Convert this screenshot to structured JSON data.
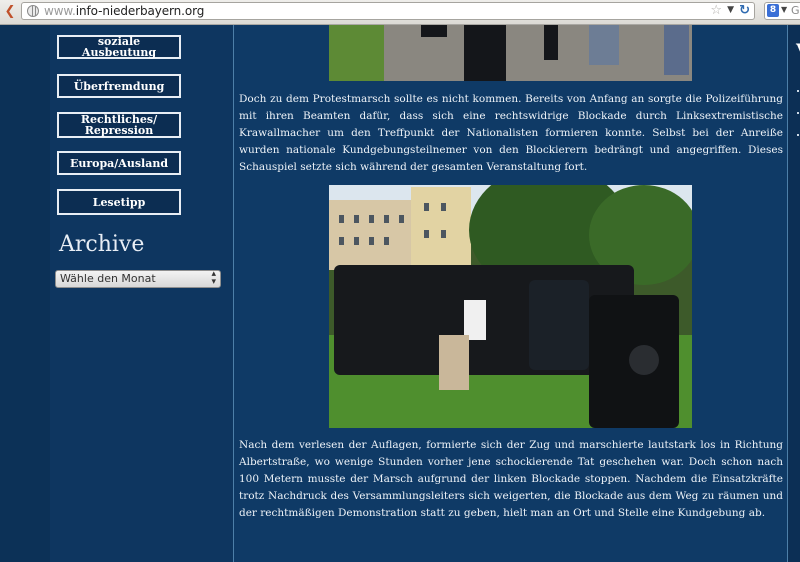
{
  "browser": {
    "url_host": "www.",
    "url_domain": "info-niederbayern.org",
    "search_engine_glyph": "8",
    "search_placeholder": "G"
  },
  "sidebar": {
    "categories": [
      {
        "label": "soziale Ausbeutung"
      },
      {
        "label": "Überfremdung"
      },
      {
        "label": "Rechtliches/ Repression"
      },
      {
        "label": "Europa/Ausland"
      },
      {
        "label": "Lesetipp"
      }
    ],
    "archive_title": "Archive",
    "archive_select_value": "Wähle den Monat"
  },
  "article": {
    "paragraph1": "Doch zu dem Protestmarsch sollte es nicht kommen. Bereits von Anfang an sorgte die Polizeiführung mit ihren Beamten dafür, dass sich eine rechtswidrige Blockade durch Linksextremistische Krawallmacher um den Treffpunkt der Nationalisten formieren konnte. Selbst bei der Anreiße wurden nationale Kundgebungsteilnemer von den Blockierern bedrängt und angegriffen. Dieses Schauspiel setzte sich während der gesamten Veranstaltung fort.",
    "paragraph2": "Nach dem verlesen der Auflagen, formierte sich der Zug und marschierte lautstark los in Richtung Albertstraße, wo wenige Stunden vorher jene schockierende Tat geschehen war. Doch schon nach 100 Metern musste der Marsch aufgrund der linken Blockade stoppen. Nachdem die Einsatzkräfte trotz Nachdruck des Versammlungsleiters sich weigerten, die Blockade aus dem Weg zu räumen und der rechtmäßigen Demonstration statt zu geben, hielt man an Ort und Stelle eine Kundgebung ab."
  },
  "right_column": {
    "heading_initial": "V"
  },
  "colors": {
    "page_background": "#0e3660",
    "content_background": "#0f3a66",
    "button_border": "#e8eef5",
    "text": "#eef3f8"
  },
  "icons": [
    "back-arrow-icon",
    "globe-icon",
    "bookmark-star-icon",
    "dropdown-icon",
    "reload-icon",
    "search-engine-icon"
  ]
}
